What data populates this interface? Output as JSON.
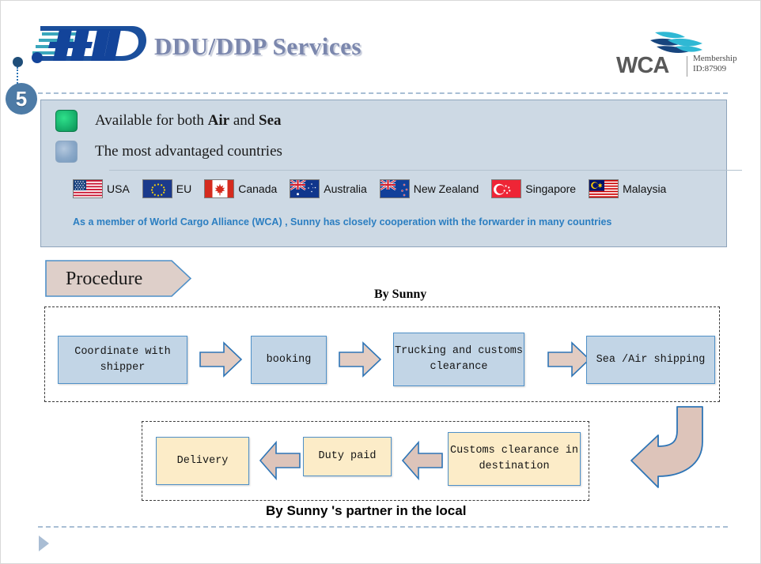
{
  "header": {
    "logo_name": "HMD",
    "title": "DDU/DDP Services",
    "wca": {
      "word": "WCA",
      "membership_line1": "Membership",
      "membership_line2": "ID:87909",
      "birds_icon": "three-birds-icon"
    }
  },
  "badge": {
    "number": "5"
  },
  "info_panel": {
    "legend": [
      {
        "swatch": "green-square-icon",
        "text_plain": "Available for both Air and Sea",
        "pre": "Available for both ",
        "bold1": "Air",
        "mid": " and ",
        "bold2": "Sea"
      },
      {
        "swatch": "blue-square-icon",
        "text_plain": "The most advantaged countries"
      }
    ],
    "flags": [
      {
        "name": "USA",
        "flag_icon": "flag-usa"
      },
      {
        "name": "EU",
        "flag_icon": "flag-eu"
      },
      {
        "name": "Canada",
        "flag_icon": "flag-canada"
      },
      {
        "name": "Australia",
        "flag_icon": "flag-australia"
      },
      {
        "name": "New Zealand",
        "flag_icon": "flag-new-zealand"
      },
      {
        "name": "Singapore",
        "flag_icon": "flag-singapore"
      },
      {
        "name": "Malaysia",
        "flag_icon": "flag-malaysia"
      }
    ],
    "caption": "As a member of World Cargo Alliance (WCA) , Sunny has closely cooperation with the forwarder in many countries"
  },
  "procedure": {
    "banner_label": "Procedure",
    "top_group_label": "By Sunny",
    "bottom_group_label": "By Sunny 's partner in the local",
    "top_steps": [
      {
        "label": "Coordinate with shipper"
      },
      {
        "label": "booking"
      },
      {
        "label": "Trucking and customs clearance"
      },
      {
        "label": "Sea /Air shipping"
      }
    ],
    "bottom_steps": [
      {
        "label": "Delivery"
      },
      {
        "label": "Duty paid"
      },
      {
        "label": "Customs clearance in destination"
      }
    ]
  },
  "colors": {
    "title": "#7b87ad",
    "panel_bg": "#cdd9e4",
    "panel_border": "#8ea4bb",
    "caption_blue": "#2b7ec1",
    "box_blue": "#c2d5e6",
    "box_cream": "#fcecc8",
    "box_border": "#4f90c8",
    "arrow_fill": "#e2ccc2",
    "badge_bg": "#4d7ba6",
    "banner_fill": "#decfc9"
  }
}
